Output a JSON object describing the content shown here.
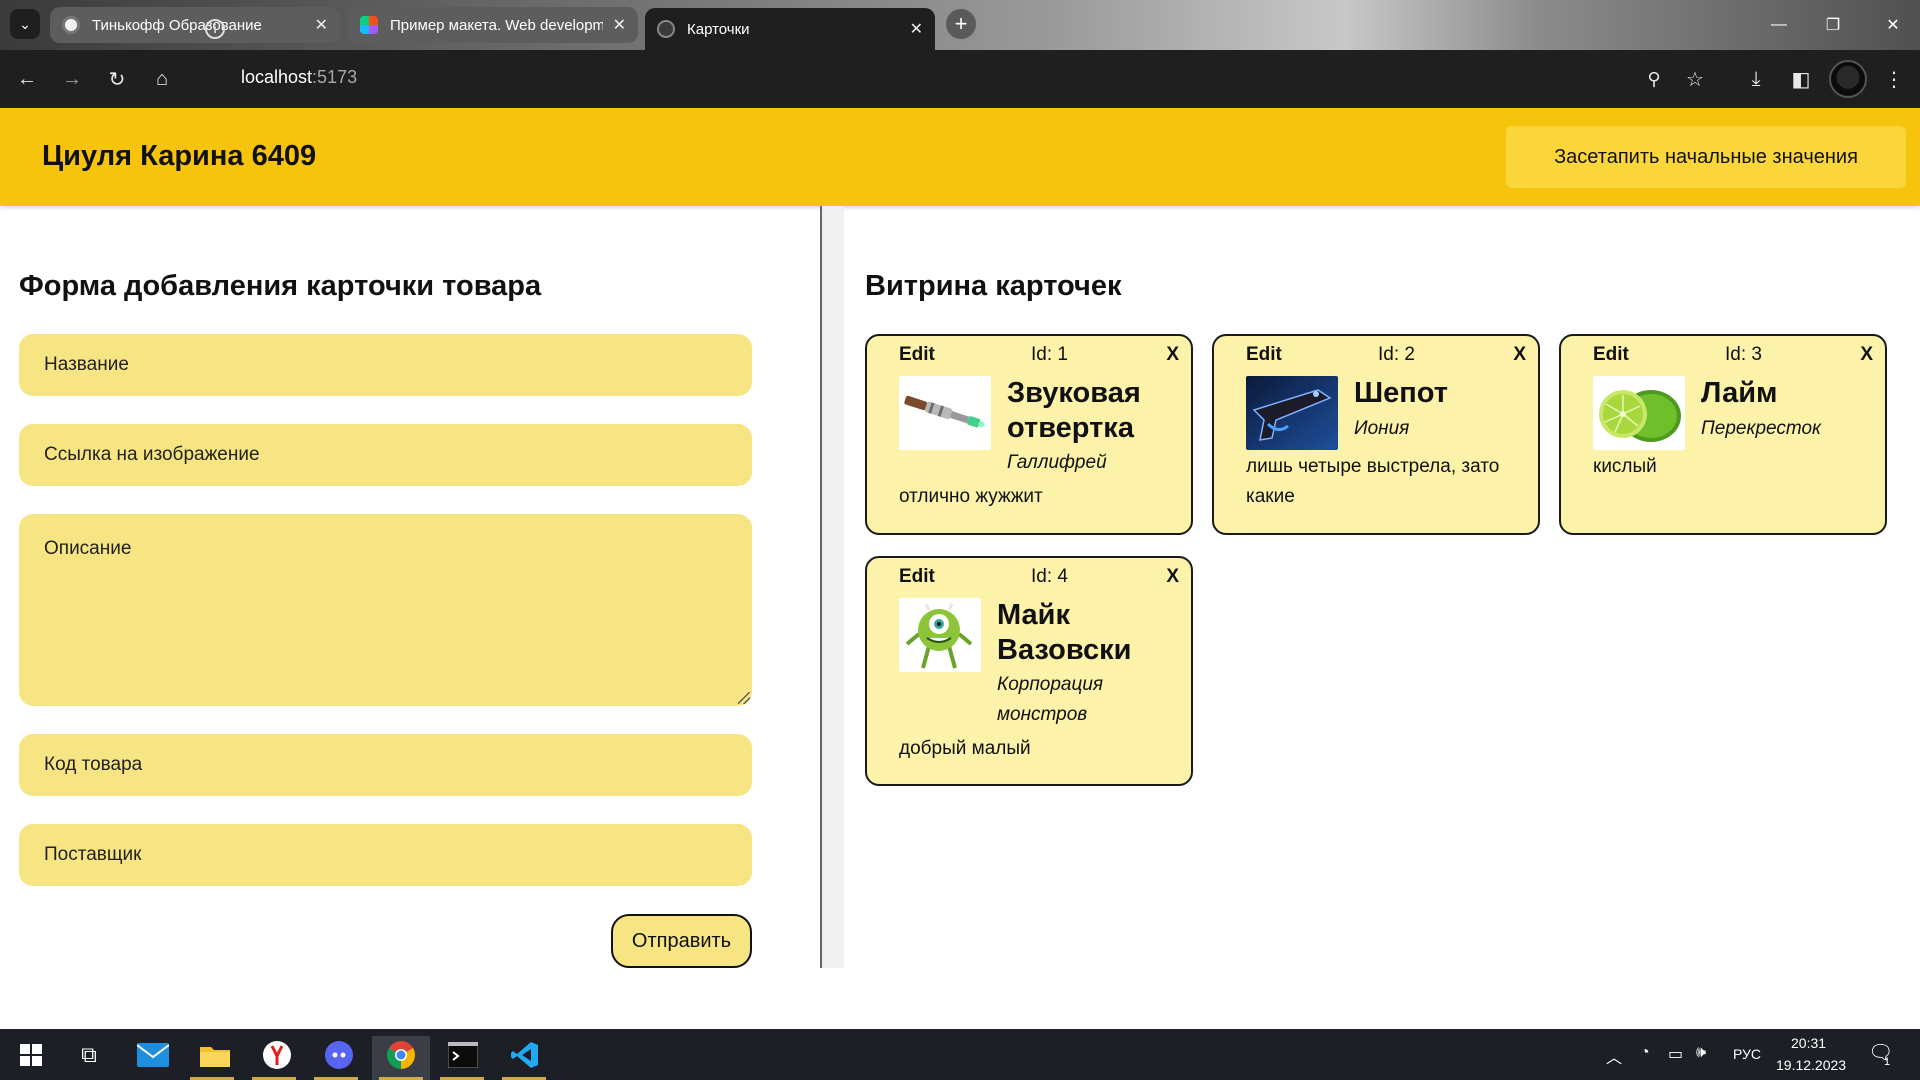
{
  "browser": {
    "tabs": [
      {
        "title": "Тинькофф Образование",
        "close": "✕"
      },
      {
        "title": "Пример макета. Web development",
        "close": "✕"
      },
      {
        "title": "Карточки",
        "close": "✕"
      }
    ],
    "new_tab": "+",
    "url_host": "localhost",
    "url_port": ":5173",
    "window_controls": [
      "—",
      "❐",
      "✕"
    ]
  },
  "header": {
    "title": "Циуля Карина 6409",
    "reset_label": "Засетапить начальные значения"
  },
  "form": {
    "heading": "Форма добавления карточки товара",
    "fields": {
      "name": "Название",
      "image_link": "Ссылка на изображение",
      "description": "Описание",
      "code": "Код товара",
      "provider": "Поставщик"
    },
    "submit_label": "Отправить"
  },
  "showcase": {
    "heading": "Витрина карточек",
    "edit_label": "Edit",
    "close_label": "X",
    "cards": [
      {
        "id": "Id: 1",
        "name": "Звуковая отвертка",
        "provider": "Галлифрей",
        "description": "отлично жужжит",
        "image": "sonic-screwdriver"
      },
      {
        "id": "Id: 2",
        "name": "Шепот",
        "provider": "Иония",
        "description": "лишь четыре выстрела, зато какие",
        "image": "whisper-gun"
      },
      {
        "id": "Id: 3",
        "name": "Лайм",
        "provider": "Перекресток",
        "description": "кислый",
        "image": "lime"
      },
      {
        "id": "Id: 4",
        "name": "Майк Вазовски",
        "provider": "Корпорация монстров",
        "description": "добрый малый",
        "image": "mike-wazowski"
      }
    ]
  },
  "taskbar": {
    "language": "РУС",
    "time": "20:31",
    "date": "19.12.2023",
    "notifications": "1"
  },
  "colors": {
    "header": "#f6c30d",
    "field": "#f7e482",
    "card": "#fdf2aa"
  }
}
